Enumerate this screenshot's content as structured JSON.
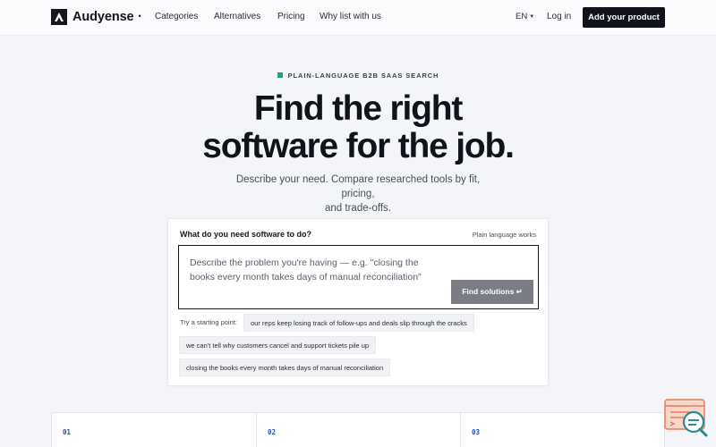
{
  "header": {
    "brand": "Audyense",
    "nav": [
      "Categories",
      "Alternatives",
      "Pricing",
      "Why list with us"
    ],
    "language": "EN",
    "login": "Log in",
    "cta": "Add your product"
  },
  "hero": {
    "eyebrow": "PLAIN-LANGUAGE B2B SAAS SEARCH",
    "title_line1": "Find the right",
    "title_line2": "software for the job.",
    "subtitle_line1": "Describe your need. Compare researched tools by fit, pricing,",
    "subtitle_line2": "and trade-offs."
  },
  "search": {
    "question": "What do you need software to do?",
    "hint": "Plain language works",
    "placeholder_line1": "Describe the problem you're having — e.g. \"closing the",
    "placeholder_line2": "books every month takes days of manual reconciliation\"",
    "button": "Find solutions ↵",
    "try_label": "Try a starting point:",
    "suggestions": [
      "our reps keep losing track of follow-ups and deals slip through the cracks",
      "we can't tell why customers cancel and support tickets pile up",
      "closing the books every month takes days of manual reconciliation"
    ]
  },
  "steps": [
    "01",
    "02",
    "03"
  ],
  "colors": {
    "accent_green": "#22a27a",
    "dark": "#11131a",
    "step_blue": "#2650b8",
    "widget_orange": "#e9795a",
    "widget_teal": "#2b8a92"
  },
  "icons": {
    "logo": "audyense-logo-icon",
    "chat_widget": "chat-support-icon"
  }
}
